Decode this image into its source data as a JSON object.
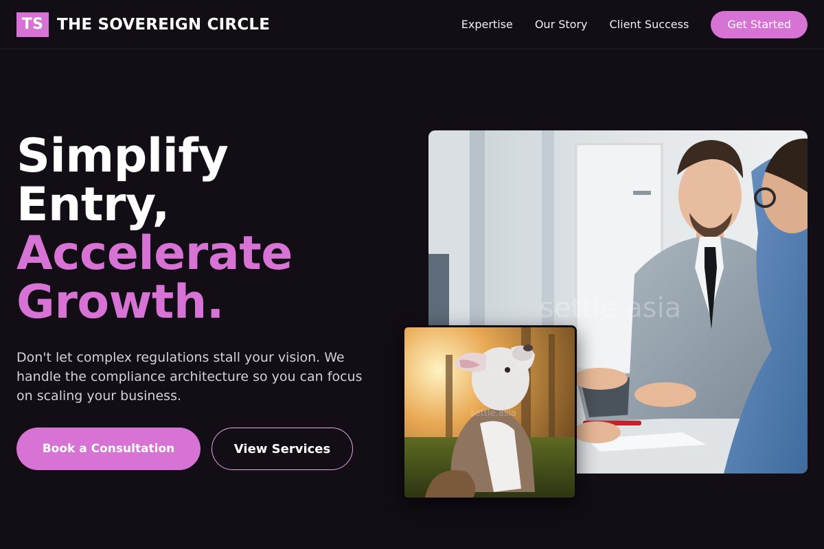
{
  "brand": {
    "logo_text": "TS",
    "name": "THE SOVEREIGN CIRCLE"
  },
  "nav": {
    "links": [
      "Expertise",
      "Our Story",
      "Client Success"
    ],
    "cta": "Get Started"
  },
  "hero": {
    "title_lines": [
      "Simplify",
      "Entry,"
    ],
    "title_accent_lines": [
      "Accelerate",
      "Growth."
    ],
    "subtitle": "Don't let complex regulations stall your vision. We handle the compliance architecture so you can focus on scaling your business.",
    "primary_button": "Book a Consultation",
    "secondary_button": "View Services"
  },
  "images": {
    "main_watermark": "settle.asia",
    "secondary_watermark": "settle.asia"
  },
  "colors": {
    "accent": "#d873d6",
    "background": "#130e16"
  }
}
